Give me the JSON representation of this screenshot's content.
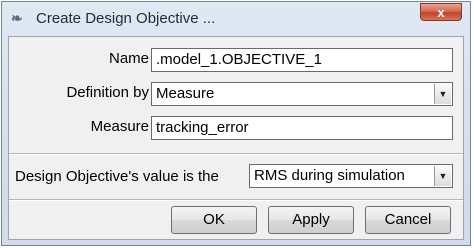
{
  "window": {
    "title": "Create Design Objective ...",
    "close_label": "x"
  },
  "form": {
    "name_label": "Name",
    "name_value": ".model_1.OBJECTIVE_1",
    "definition_label": "Definition by",
    "definition_value": "Measure",
    "measure_label": "Measure",
    "measure_value": "tracking_error",
    "objective_label": "Design Objective's value is the",
    "objective_value": "RMS during simulation"
  },
  "buttons": {
    "ok": "OK",
    "apply": "Apply",
    "cancel": "Cancel"
  },
  "icons": {
    "app": "feather-icon",
    "dropdown": "chevron-down-icon"
  }
}
